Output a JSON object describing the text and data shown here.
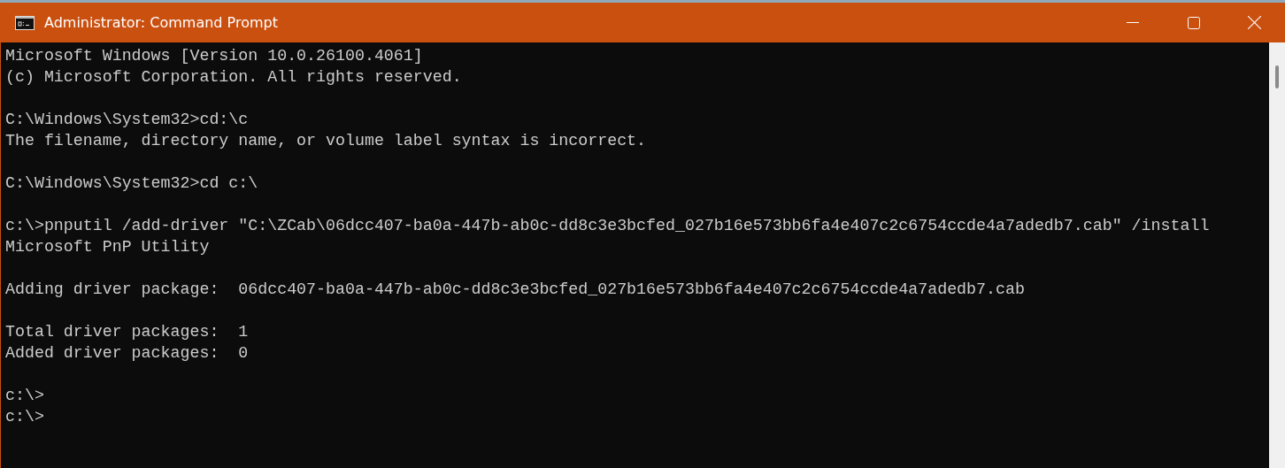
{
  "window": {
    "title": "Administrator: Command Prompt"
  },
  "console": {
    "blocks": [
      [
        "Microsoft Windows [Version 10.0.26100.4061]",
        "(c) Microsoft Corporation. All rights reserved."
      ],
      [
        "C:\\Windows\\System32>cd:\\c",
        "The filename, directory name, or volume label syntax is incorrect."
      ],
      [
        "C:\\Windows\\System32>cd c:\\"
      ],
      [
        "c:\\>pnputil /add-driver \"C:\\ZCab\\06dcc407-ba0a-447b-ab0c-dd8c3e3bcfed_027b16e573bb6fa4e407c2c6754ccde4a7adedb7.cab\" /install",
        "Microsoft PnP Utility"
      ],
      [
        "Adding driver package:  06dcc407-ba0a-447b-ab0c-dd8c3e3bcfed_027b16e573bb6fa4e407c2c6754ccde4a7adedb7.cab"
      ],
      [
        "Total driver packages:  1",
        "Added driver packages:  0"
      ],
      [
        "c:\\>",
        "c:\\>"
      ]
    ]
  }
}
